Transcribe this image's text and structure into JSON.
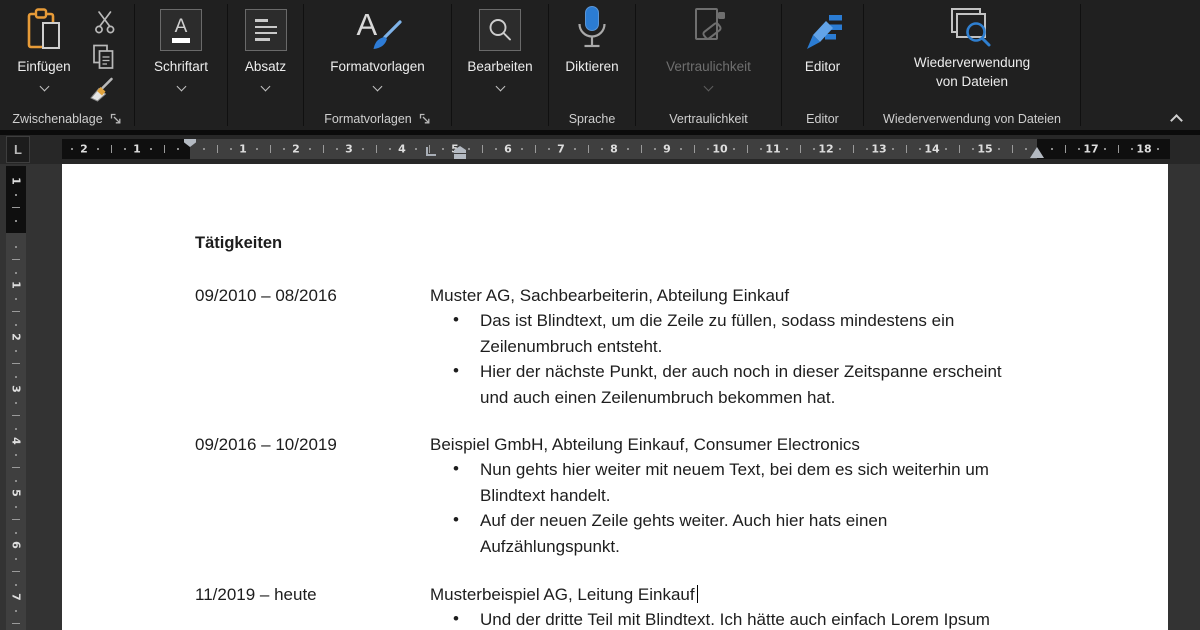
{
  "ribbon": {
    "groups": {
      "clipboard": {
        "paste_button": "Einfügen",
        "label": "Zwischenablage"
      },
      "font": {
        "button": "Schriftart"
      },
      "paragraph": {
        "button": "Absatz"
      },
      "styles": {
        "button": "Formatvorlagen",
        "label": "Formatvorlagen"
      },
      "editing": {
        "button": "Bearbeiten"
      },
      "speech": {
        "button": "Diktieren",
        "label": "Sprache"
      },
      "sensitivity": {
        "button": "Vertraulichkeit",
        "label": "Vertraulichkeit",
        "disabled": true
      },
      "editor": {
        "button": "Editor",
        "label": "Editor"
      },
      "reuse": {
        "button_line1": "Wiederverwendung",
        "button_line2": "von Dateien",
        "label": "Wiederverwendung von Dateien"
      }
    }
  },
  "ruler": {
    "tab_selector": "L",
    "horizontal_numbers": [
      {
        "label": "2",
        "u": -2
      },
      {
        "label": "1",
        "u": -1
      },
      {
        "label": "1",
        "u": 1
      },
      {
        "label": "2",
        "u": 2
      },
      {
        "label": "3",
        "u": 3
      },
      {
        "label": "4",
        "u": 4
      },
      {
        "label": "5",
        "u": 5
      },
      {
        "label": "6",
        "u": 6
      },
      {
        "label": "7",
        "u": 7
      },
      {
        "label": "8",
        "u": 8
      },
      {
        "label": "9",
        "u": 9
      },
      {
        "label": "10",
        "u": 10
      },
      {
        "label": "11",
        "u": 11
      },
      {
        "label": "12",
        "u": 12
      },
      {
        "label": "13",
        "u": 13
      },
      {
        "label": "14",
        "u": 14
      },
      {
        "label": "15",
        "u": 15
      },
      {
        "label": "17",
        "u": 17
      },
      {
        "label": "18",
        "u": 18
      }
    ],
    "vertical_numbers": [
      {
        "label": "1",
        "u": -1
      },
      {
        "label": "1",
        "u": 1
      },
      {
        "label": "2",
        "u": 2
      },
      {
        "label": "3",
        "u": 3
      },
      {
        "label": "4",
        "u": 4
      },
      {
        "label": "5",
        "u": 5
      },
      {
        "label": "6",
        "u": 6
      },
      {
        "label": "7",
        "u": 7
      }
    ]
  },
  "icons": {
    "bullet": "•"
  },
  "colors": {
    "accent_blue": "#2b7cd3",
    "clipboard_orange": "#e79b38",
    "page_white": "#ffffff",
    "ribbon_bg": "#202020",
    "disabled_gray": "#6f6f6f"
  },
  "document": {
    "heading": "Tätigkeiten",
    "entries": [
      {
        "date": "09/2010 – 08/2016",
        "title": "Muster AG, Sachbearbeiterin, Abteilung Einkauf",
        "cursor": false,
        "bullets": [
          {
            "lines": [
              "Das ist Blindtext, um die Zeile zu füllen, sodass mindestens ein",
              "Zeilenumbruch entsteht."
            ]
          },
          {
            "lines": [
              "Hier der nächste Punkt, der auch noch in dieser Zeitspanne erscheint",
              "und auch einen Zeilenumbruch bekommen hat."
            ]
          }
        ]
      },
      {
        "date": "09/2016 – 10/2019",
        "title": "Beispiel GmbH, Abteilung Einkauf, Consumer Electronics",
        "cursor": false,
        "bullets": [
          {
            "lines": [
              "Nun gehts hier weiter mit neuem Text, bei dem es sich weiterhin um",
              "Blindtext handelt."
            ]
          },
          {
            "lines": [
              "Auf der neuen Zeile gehts weiter. Auch hier hats einen",
              "Aufzählungspunkt."
            ]
          }
        ]
      },
      {
        "date": "11/2019 – heute",
        "title": "Musterbeispiel AG, Leitung Einkauf",
        "cursor": true,
        "bullets": [
          {
            "lines": [
              "Und der dritte Teil mit Blindtext. Ich hätte auch einfach Lorem Ipsum"
            ]
          }
        ]
      }
    ]
  }
}
